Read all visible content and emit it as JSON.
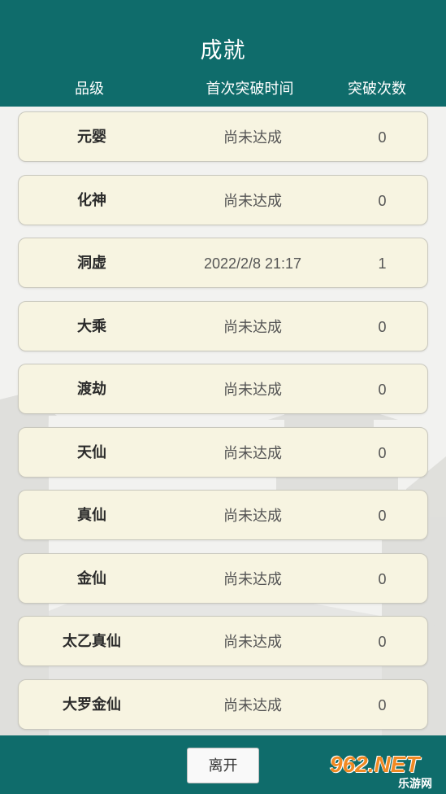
{
  "header": {
    "title": "成就",
    "columns": {
      "grade": "品级",
      "time": "首次突破时间",
      "count": "突破次数"
    }
  },
  "rows": [
    {
      "grade": "元婴",
      "time": "尚未达成",
      "count": "0"
    },
    {
      "grade": "化神",
      "time": "尚未达成",
      "count": "0"
    },
    {
      "grade": "洞虚",
      "time": "2022/2/8 21:17",
      "count": "1"
    },
    {
      "grade": "大乘",
      "time": "尚未达成",
      "count": "0"
    },
    {
      "grade": "渡劫",
      "time": "尚未达成",
      "count": "0"
    },
    {
      "grade": "天仙",
      "time": "尚未达成",
      "count": "0"
    },
    {
      "grade": "真仙",
      "time": "尚未达成",
      "count": "0"
    },
    {
      "grade": "金仙",
      "time": "尚未达成",
      "count": "0"
    },
    {
      "grade": "太乙真仙",
      "time": "尚未达成",
      "count": "0"
    },
    {
      "grade": "大罗金仙",
      "time": "尚未达成",
      "count": "0"
    }
  ],
  "footer": {
    "leave_label": "离开",
    "watermark": {
      "main": "962.NET",
      "sub": "乐游网"
    }
  },
  "colors": {
    "header_bg": "#0f6c6b",
    "row_bg": "#f7f4e1",
    "watermark": "#f08a24"
  }
}
